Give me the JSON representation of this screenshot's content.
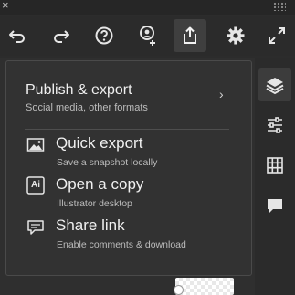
{
  "top_strip": {
    "close_glyph": "×",
    "grip_icon": "grip-dots-icon"
  },
  "toolbar": {
    "undo_icon": "undo-icon",
    "redo_icon": "redo-icon",
    "help_icon": "help-icon",
    "invite_icon": "add-user-icon",
    "share_icon": "share-export-icon",
    "settings_icon": "gear-icon",
    "fullscreen_icon": "fullscreen-icon",
    "active_color": "#3f3f3f"
  },
  "popover": {
    "header": {
      "title": "Publish & export",
      "subtitle": "Social media, other formats",
      "chevron": "›"
    },
    "items": [
      {
        "title": "Quick export",
        "subtitle": "Save a snapshot locally",
        "icon": "image-icon"
      },
      {
        "title": "Open a copy",
        "subtitle": "Illustrator desktop",
        "icon": "illustrator-icon",
        "badge": "Ai"
      },
      {
        "title": "Share link",
        "subtitle": "Enable comments & download",
        "icon": "comment-icon"
      }
    ]
  },
  "rail": {
    "items": [
      {
        "icon": "layers-icon",
        "active": true
      },
      {
        "icon": "properties-sliders-icon",
        "active": false
      },
      {
        "icon": "grid-icon",
        "active": false
      },
      {
        "icon": "comment-icon",
        "active": false
      }
    ]
  }
}
